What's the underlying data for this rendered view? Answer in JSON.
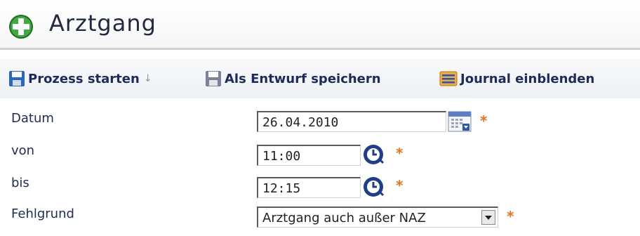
{
  "page": {
    "title": "Arztgang",
    "title_icon": "plus-circle-icon"
  },
  "toolbar": {
    "start_label": "Prozess starten",
    "start_icon": "save-disk-icon",
    "more_icon": "chevron-double-down-icon",
    "draft_label": "Als Entwurf speichern",
    "draft_icon": "save-disk-gray-icon",
    "journal_label": "Journal einblenden",
    "journal_icon": "journal-list-icon"
  },
  "form": {
    "datum": {
      "label": "Datum",
      "value": "26.04.2010",
      "icon": "calendar-icon",
      "required": "*"
    },
    "von": {
      "label": "von",
      "value": "11:00",
      "icon": "clock-icon",
      "required": "*"
    },
    "bis": {
      "label": "bis",
      "value": "12:15",
      "icon": "clock-icon",
      "required": "*"
    },
    "fehlgrund": {
      "label": "Fehlgrund",
      "value": "Arztgang auch außer NAZ",
      "icon": "dropdown-arrow-icon",
      "required": "*"
    }
  },
  "colors": {
    "accent": "#1c2b5a",
    "required": "#e8731a",
    "title_icon": "#2e9a2e"
  }
}
